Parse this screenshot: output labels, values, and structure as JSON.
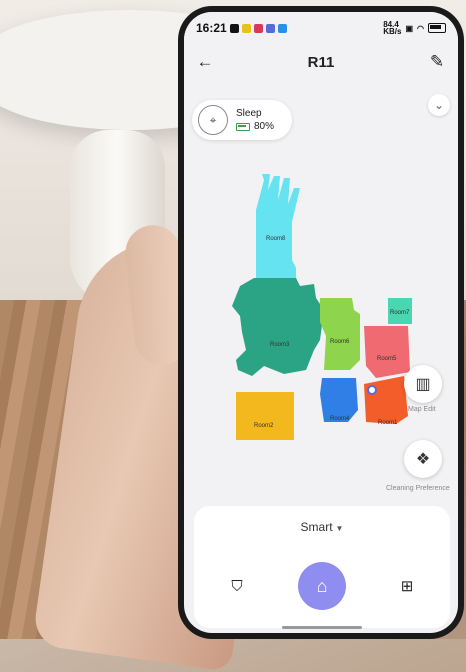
{
  "status_bar": {
    "time": "16:21",
    "net_speed": "84.4\nKB/s"
  },
  "header": {
    "title": "R11"
  },
  "robot_status": {
    "state": "Sleep",
    "battery": "80%"
  },
  "rooms": [
    {
      "name": "Room8",
      "color": "#66e3f0"
    },
    {
      "name": "Room3",
      "color": "#2ba486"
    },
    {
      "name": "Room6",
      "color": "#8ed44c"
    },
    {
      "name": "Room7",
      "color": "#49d6b0"
    },
    {
      "name": "Room5",
      "color": "#f06a72"
    },
    {
      "name": "Room2",
      "color": "#f2b81d"
    },
    {
      "name": "Room4",
      "color": "#2f7fe6"
    },
    {
      "name": "Room1",
      "color": "#f25d2a"
    }
  ],
  "side_buttons": {
    "map_edit": "Map Edit",
    "cleaning_preference": "Cleaning Preference"
  },
  "panel": {
    "mode": "Smart"
  }
}
